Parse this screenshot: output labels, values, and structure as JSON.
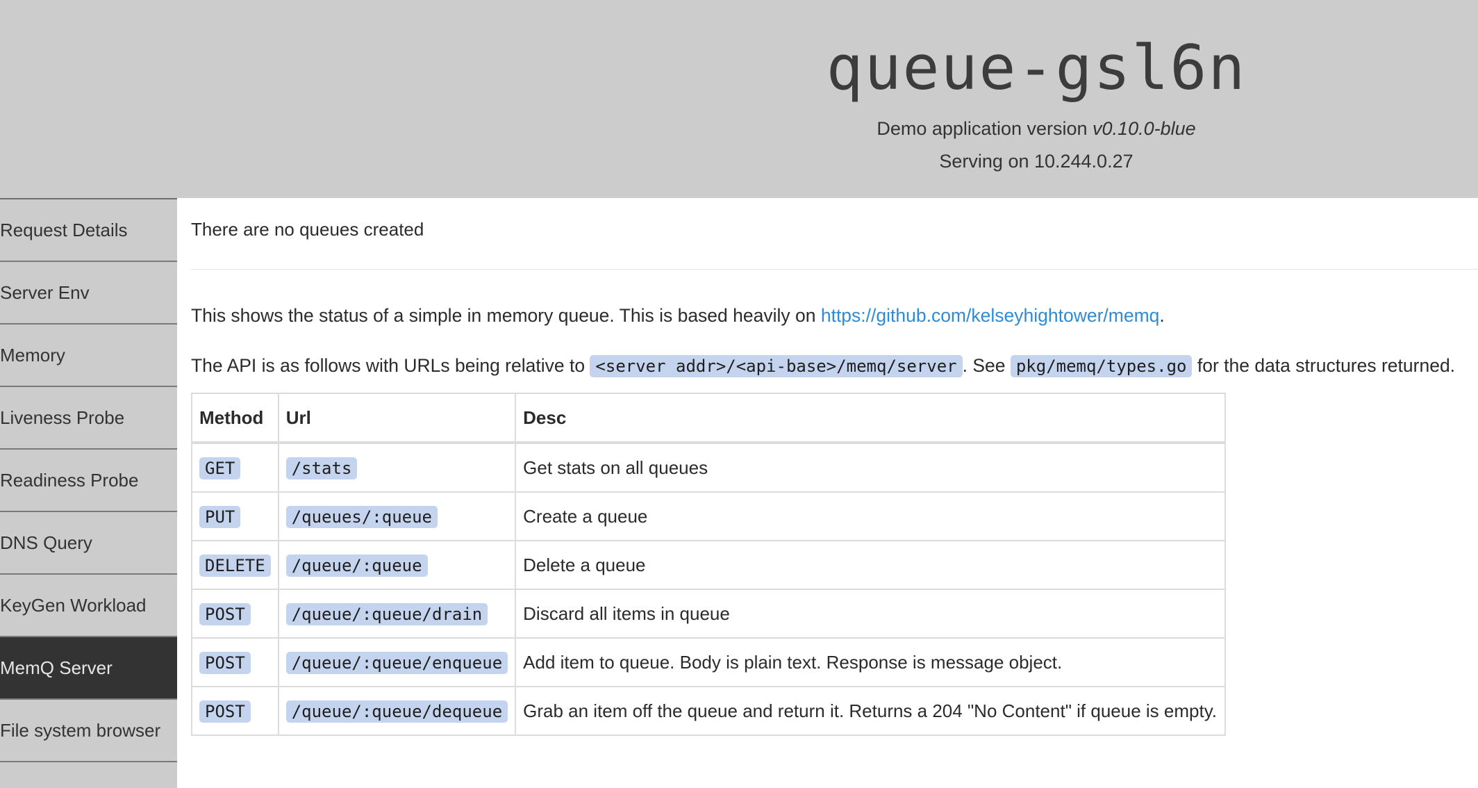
{
  "header": {
    "title": "queue-gsl6n",
    "version_prefix": "Demo application version ",
    "version": "v0.10.0-blue",
    "serving": "Serving on 10.244.0.27"
  },
  "sidebar": {
    "items": [
      {
        "label": "Request Details"
      },
      {
        "label": "Server Env"
      },
      {
        "label": "Memory"
      },
      {
        "label": "Liveness Probe"
      },
      {
        "label": "Readiness Probe"
      },
      {
        "label": "DNS Query"
      },
      {
        "label": "KeyGen Workload"
      },
      {
        "label": "MemQ Server",
        "active": true
      },
      {
        "label": "File system browser"
      }
    ]
  },
  "main": {
    "no_queues": "There are no queues created",
    "intro_text": "This shows the status of a simple in memory queue. This is based heavily on ",
    "intro_link": "https://github.com/kelseyhightower/memq",
    "intro_end": ".",
    "api_text_1": "The API is as follows with URLs being relative to ",
    "api_code_1": "<server addr>/<api-base>/memq/server",
    "api_text_2": ". See ",
    "api_code_2": "pkg/memq/types.go",
    "api_text_3": " for the data structures returned.",
    "table": {
      "headers": [
        "Method",
        "Url",
        "Desc"
      ],
      "rows": [
        {
          "method": "GET",
          "url": "/stats",
          "desc": "Get stats on all queues"
        },
        {
          "method": "PUT",
          "url": "/queues/:queue",
          "desc": "Create a queue"
        },
        {
          "method": "DELETE",
          "url": "/queue/:queue",
          "desc": "Delete a queue"
        },
        {
          "method": "POST",
          "url": "/queue/:queue/drain",
          "desc": "Discard all items in queue"
        },
        {
          "method": "POST",
          "url": "/queue/:queue/enqueue",
          "desc": "Add item to queue. Body is plain text. Response is message object."
        },
        {
          "method": "POST",
          "url": "/queue/:queue/dequeue",
          "desc": "Grab an item off the queue and return it. Returns a 204 \"No Content\" if queue is empty."
        }
      ]
    }
  },
  "colors": {
    "header_bg": "#cccccc",
    "sidebar_active_bg": "#333333",
    "link": "#2f8bd6",
    "code_bg": "#c5d4ee"
  }
}
